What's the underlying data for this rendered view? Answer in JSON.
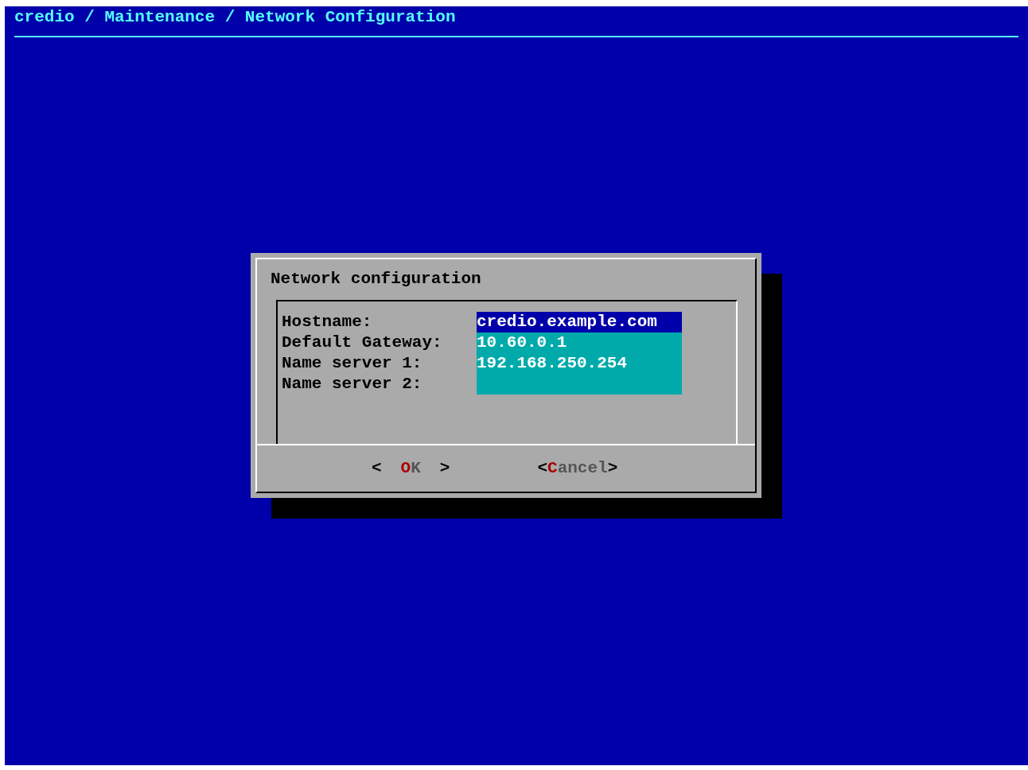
{
  "breadcrumb": "credio / Maintenance / Network Configuration",
  "dialog": {
    "title": "Network configuration",
    "fields": [
      {
        "label": "Hostname:",
        "value": "credio.example.com",
        "selected": true
      },
      {
        "label": "Default Gateway:",
        "value": "10.60.0.1",
        "selected": false
      },
      {
        "label": "Name server 1:",
        "value": "192.168.250.254",
        "selected": false
      },
      {
        "label": "Name server 2:",
        "selected": false
      }
    ],
    "buttons": [
      {
        "left": "<",
        "hotkey": "O",
        "rest": "K",
        "right": ">",
        "spaced": true
      },
      {
        "left": "<",
        "hotkey": "C",
        "rest": "ancel",
        "right": ">",
        "spaced": false
      }
    ]
  }
}
